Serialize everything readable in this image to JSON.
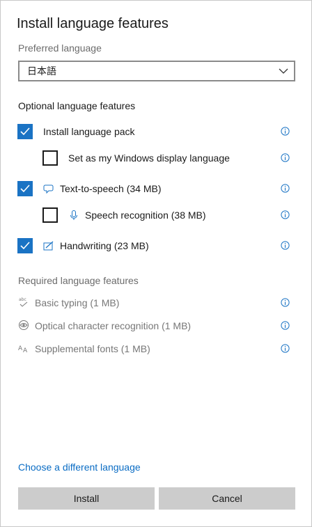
{
  "title": "Install language features",
  "preferred": {
    "label": "Preferred language",
    "value": "日本語"
  },
  "optional": {
    "heading": "Optional language features",
    "items": [
      {
        "label": "Install language pack",
        "checked": true
      },
      {
        "label": "Set as my Windows display language",
        "checked": false
      },
      {
        "label": "Text-to-speech (34 MB)",
        "checked": true,
        "icon": "speech-bubble-icon"
      },
      {
        "label": "Speech recognition (38 MB)",
        "checked": false,
        "icon": "microphone-icon"
      },
      {
        "label": "Handwriting (23 MB)",
        "checked": true,
        "icon": "pen-icon"
      }
    ]
  },
  "required": {
    "heading": "Required language features",
    "items": [
      {
        "label": "Basic typing (1 MB)",
        "icon": "abc-check-icon"
      },
      {
        "label": "Optical character recognition (1 MB)",
        "icon": "ocr-eye-icon"
      },
      {
        "label": "Supplemental fonts (1 MB)",
        "icon": "font-aa-icon"
      }
    ]
  },
  "link": "Choose a different language",
  "buttons": {
    "install": "Install",
    "cancel": "Cancel"
  },
  "colors": {
    "accent": "#1a73c4",
    "link": "#0a6cc4",
    "button_bg": "#cccccc"
  }
}
